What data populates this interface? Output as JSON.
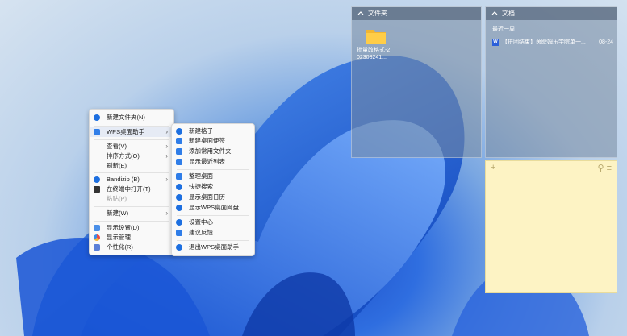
{
  "fences": {
    "folders": {
      "title": "文件夹",
      "items": [
        {
          "name_line1": "批量改格式-2",
          "name_line2": "02308241..."
        }
      ]
    },
    "documents": {
      "title": "文档",
      "section": "最近一周",
      "items": [
        {
          "name": "【拼团结束】茵睫姆乐学院单一...",
          "date": "08-24"
        }
      ]
    }
  },
  "sticky_note": {
    "add_symbol": "+",
    "pin_symbol": "⚲",
    "menu_symbol": "≡"
  },
  "context_menu": {
    "items": [
      {
        "label": "新建文件夹(N)",
        "icon": "new-folder-icon"
      },
      {
        "label": "WPS桌面助手",
        "icon": "wps-desktop-icon",
        "arrow": "›"
      },
      {
        "label": "查看(V)",
        "arrow": "›"
      },
      {
        "label": "排序方式(O)",
        "arrow": "›"
      },
      {
        "label": "刷新(E)"
      },
      {
        "label": "Bandizip (B)",
        "icon": "bandizip-icon",
        "arrow": "›"
      },
      {
        "label": "在终端中打开(T)",
        "icon": "terminal-icon"
      },
      {
        "label": "粘贴(P)",
        "disabled": true
      },
      {
        "label": "新建(W)",
        "arrow": "›"
      },
      {
        "label": "显示设置(D)",
        "icon": "display-settings-icon"
      },
      {
        "label": "显示管理",
        "icon": "display-manage-icon"
      },
      {
        "label": "个性化(R)",
        "icon": "personalize-icon"
      }
    ]
  },
  "submenu": {
    "items": [
      {
        "label": "新建格子",
        "icon": "plus-circle-icon"
      },
      {
        "label": "新建桌面便签",
        "icon": "note-icon"
      },
      {
        "label": "添加常用文件夹",
        "icon": "folder-add-icon"
      },
      {
        "label": "显示最近列表",
        "icon": "recent-list-icon"
      },
      {
        "label": "整理桌面",
        "icon": "organize-icon"
      },
      {
        "label": "快捷搜索",
        "icon": "search-icon"
      },
      {
        "label": "显示桌面日历",
        "icon": "calendar-icon"
      },
      {
        "label": "显示WPS桌面网盘",
        "icon": "cloud-icon"
      },
      {
        "label": "设置中心",
        "icon": "gear-icon"
      },
      {
        "label": "建议反馈",
        "icon": "feedback-icon"
      },
      {
        "label": "退出WPS桌面助手",
        "icon": "exit-icon"
      }
    ]
  }
}
